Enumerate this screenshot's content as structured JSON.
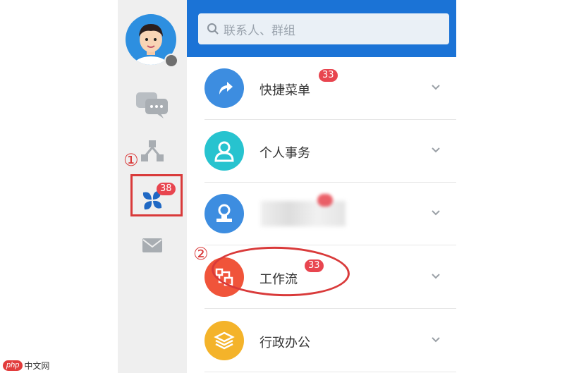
{
  "search": {
    "placeholder": "联系人、群组"
  },
  "sidebar": {
    "apps_badge": "38",
    "annotation_1": "①",
    "items": [
      {
        "icon": "chat-icon"
      },
      {
        "icon": "org-chart-icon"
      },
      {
        "icon": "apps-icon"
      },
      {
        "icon": "mail-icon"
      }
    ]
  },
  "menu": {
    "annotation_2": "②",
    "items": [
      {
        "label": "快捷菜单",
        "badge": "33",
        "icon": "shortcut-icon",
        "color": "#3d8de0"
      },
      {
        "label": "个人事务",
        "badge": "",
        "icon": "person-icon",
        "color": "#27c3cf"
      },
      {
        "label": "",
        "badge": "",
        "icon": "stamp-icon",
        "color": "#3d8de0"
      },
      {
        "label": "工作流",
        "badge": "33",
        "icon": "workflow-icon",
        "color": "#f0543a"
      },
      {
        "label": "行政办公",
        "badge": "",
        "icon": "layers-icon",
        "color": "#f4b32a"
      }
    ]
  },
  "watermark": {
    "logo": "php",
    "text": "中文网"
  }
}
